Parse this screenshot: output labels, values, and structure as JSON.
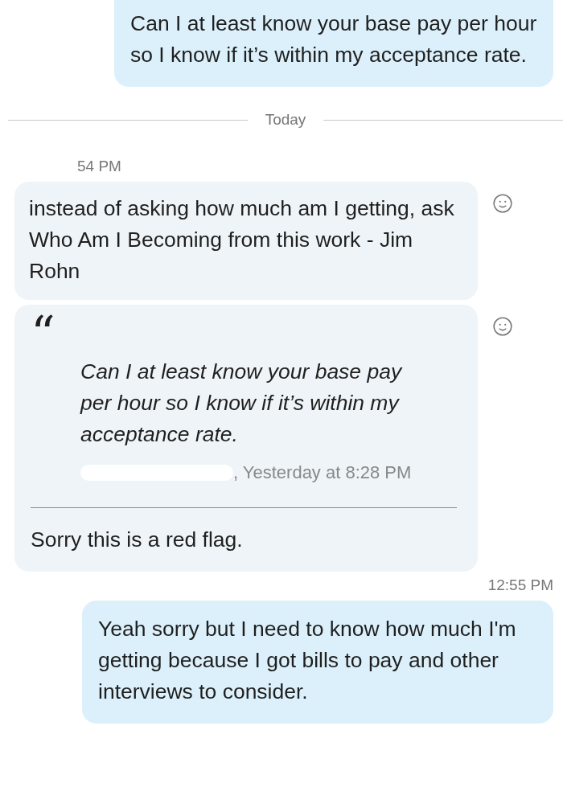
{
  "items": [
    {
      "kind": "outgoing",
      "text": "Can I at least know your base pay per hour so I know if it’s within my acceptance rate."
    },
    {
      "kind": "divider",
      "text": "Today"
    },
    {
      "kind": "received_time",
      "text": "54 PM"
    },
    {
      "kind": "incoming",
      "text": "instead of asking how much am I getting, ask Who Am I Becoming from this work - Jim Rohn"
    },
    {
      "kind": "reply",
      "quote_mark": "“",
      "quote": "Can I at least know your base pay per hour so I know if it’s within my acceptance rate.",
      "meta": ", Yesterday at 8:28 PM",
      "text": "Sorry this is a red flag."
    },
    {
      "kind": "sent_time",
      "text": "12:55 PM"
    },
    {
      "kind": "outgoing",
      "text": "Yeah sorry but I need to know how much I'm getting because I got bills to pay and other interviews to consider."
    }
  ]
}
